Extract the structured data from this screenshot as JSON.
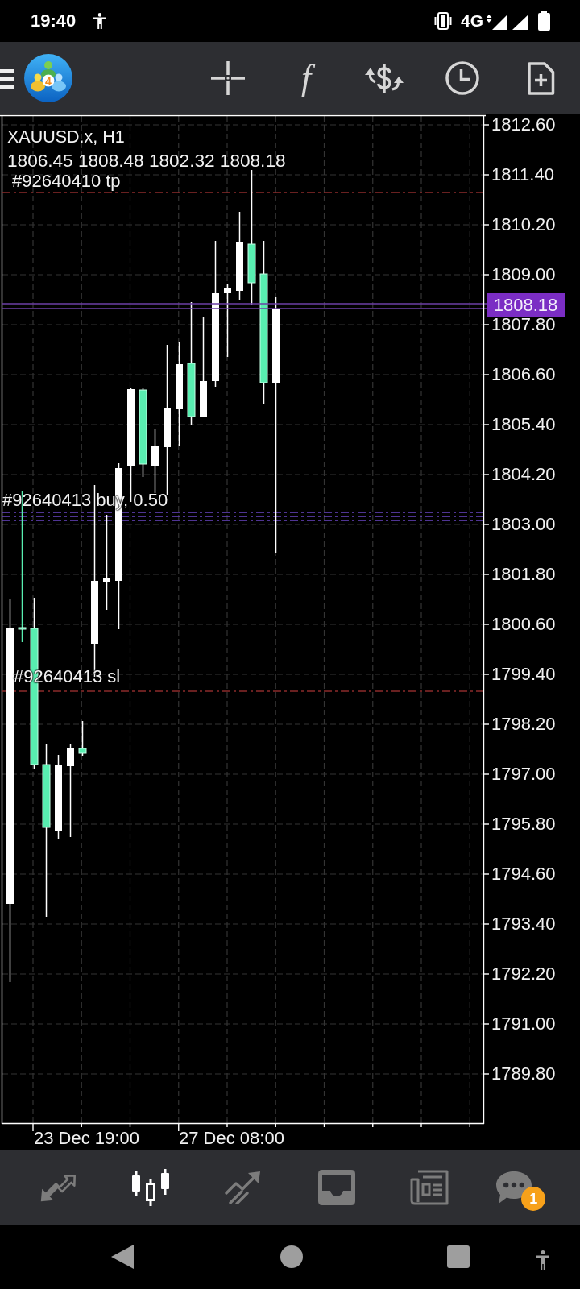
{
  "status_bar": {
    "time": "19:40",
    "network": "4G"
  },
  "toolbar": {
    "logo_mark": "4",
    "indicators_symbol": "f"
  },
  "chart": {
    "symbol": "XAUUSD.x, H1",
    "ohlc": "1806.45 1808.48 1802.32 1808.18",
    "order_lines": [
      {
        "kind": "tp",
        "label": "#92640410 tp"
      },
      {
        "kind": "buy",
        "label": "#92640413 buy, 0.50"
      },
      {
        "kind": "sl",
        "label": "#92640413 sl"
      }
    ],
    "current_price": "1808.18",
    "price_axis": [
      "1812.60",
      "1811.40",
      "1810.20",
      "1809.00",
      "1807.80",
      "1806.60",
      "1805.40",
      "1804.20",
      "1803.00",
      "1801.80",
      "1800.60",
      "1799.40",
      "1798.20",
      "1797.00",
      "1795.80",
      "1794.60",
      "1793.40",
      "1792.20",
      "1791.00",
      "1789.80"
    ],
    "time_axis": [
      "23 Dec 19:00",
      "27 Dec 08:00"
    ]
  },
  "bottom_nav": [
    {
      "kind": "quotes",
      "selected": false
    },
    {
      "kind": "chart",
      "selected": true
    },
    {
      "kind": "trade",
      "selected": false
    },
    {
      "kind": "history",
      "selected": false
    },
    {
      "kind": "news",
      "selected": false
    },
    {
      "kind": "messages",
      "selected": false,
      "badge": "1"
    }
  ]
}
